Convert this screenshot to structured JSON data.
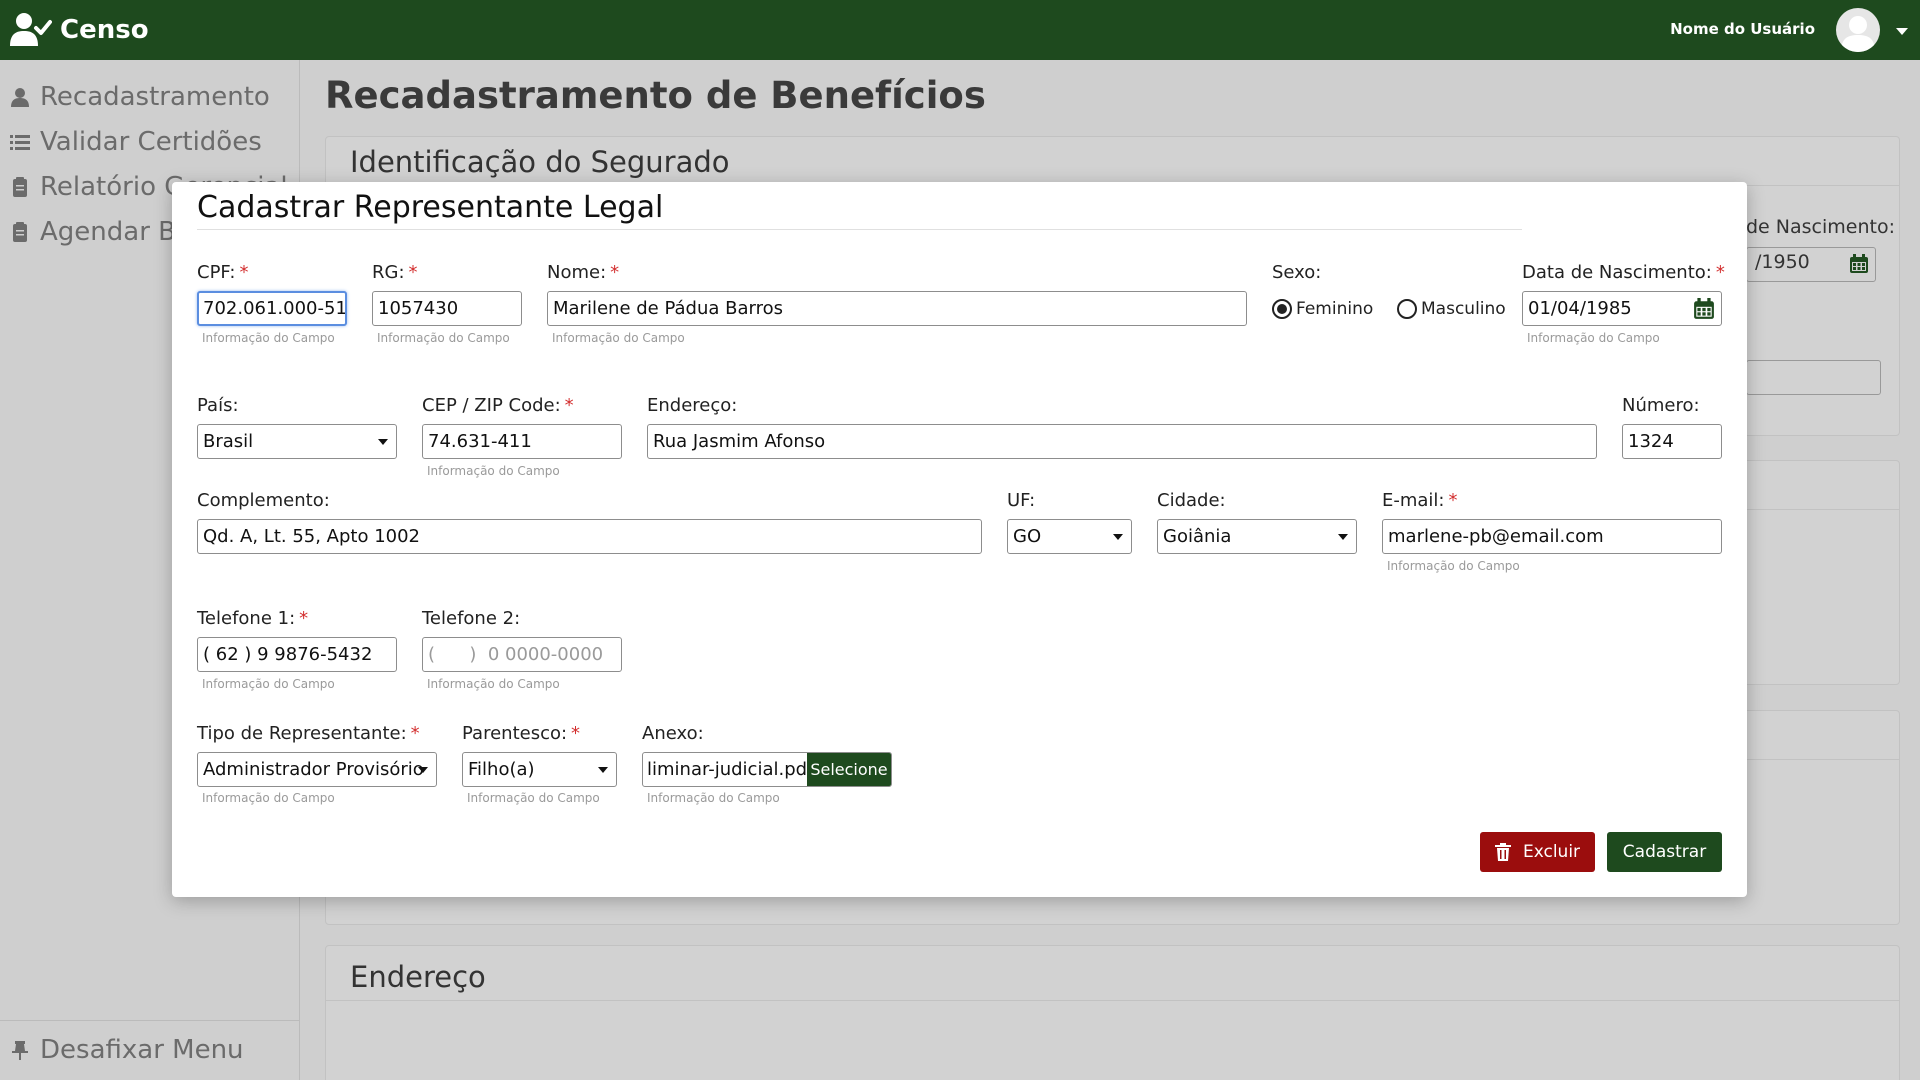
{
  "app": {
    "name": "Censo",
    "user_name": "Nome do Usuário"
  },
  "sidebar": {
    "items": [
      {
        "label": "Recadastramento",
        "icon": "user-icon"
      },
      {
        "label": "Validar Certidões",
        "icon": "list-icon"
      },
      {
        "label": "Relatório Gerencial",
        "icon": "clipboard-icon"
      },
      {
        "label": "Agendar Bloqueio",
        "icon": "clipboard-icon"
      }
    ],
    "unpin_label": "Desafixar Menu"
  },
  "page": {
    "title": "Recadastramento de Benefícios",
    "section_identificacao": "Identificação do Segurado",
    "section_endereco": "Endereço",
    "bg_birth_label": "de Nascimento:",
    "bg_birth_value": "/1950"
  },
  "modal": {
    "title": "Cadastrar Representante Legal",
    "hint": "Informação do Campo",
    "fields": {
      "cpf": {
        "label": "CPF:",
        "value": "702.061.000-51"
      },
      "rg": {
        "label": "RG:",
        "value": "1057430"
      },
      "nome": {
        "label": "Nome:",
        "value": "Marilene de Pádua Barros"
      },
      "sexo": {
        "label": "Sexo:",
        "options": [
          "Feminino",
          "Masculino"
        ],
        "selected": "Feminino"
      },
      "nascimento": {
        "label": "Data de Nascimento:",
        "value": "01/04/1985"
      },
      "pais": {
        "label": "País:",
        "value": "Brasil"
      },
      "cep": {
        "label": "CEP / ZIP Code:",
        "value": "74.631-411"
      },
      "endereco": {
        "label": "Endereço:",
        "value": "Rua Jasmim Afonso"
      },
      "numero": {
        "label": "Número:",
        "value": "1324"
      },
      "complemento": {
        "label": "Complemento:",
        "value": "Qd. A, Lt. 55, Apto 1002"
      },
      "uf": {
        "label": "UF:",
        "value": "GO"
      },
      "cidade": {
        "label": "Cidade:",
        "value": "Goiânia"
      },
      "email": {
        "label": "E-mail:",
        "value": "marlene-pb@email.com"
      },
      "telefone1": {
        "label": "Telefone 1:",
        "value": "( 62 ) 9 9876-5432"
      },
      "telefone2": {
        "label": "Telefone 2:",
        "placeholder": "(      )  0 0000-0000"
      },
      "tipo": {
        "label": "Tipo de Representante:",
        "value": "Administrador Provisório"
      },
      "parentesco": {
        "label": "Parentesco:",
        "value": "Filho(a)"
      },
      "anexo": {
        "label": "Anexo:",
        "file": "liminar-judicial.pdf",
        "button": "Selecione"
      }
    },
    "required_mark": "*",
    "buttons": {
      "excluir": "Excluir",
      "cadastrar": "Cadastrar"
    }
  },
  "colors": {
    "brand": "#1e4a1e",
    "danger": "#9b0d0d",
    "required": "#d32f2f",
    "focus": "#5b8ee0"
  }
}
